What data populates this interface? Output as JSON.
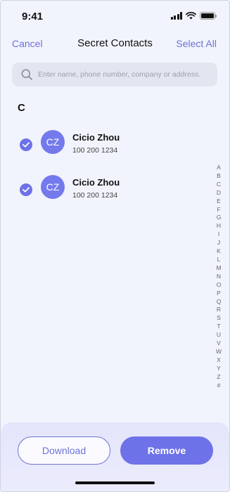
{
  "status": {
    "time": "9:41"
  },
  "nav": {
    "cancel": "Cancel",
    "title": "Secret Contacts",
    "select_all": "Select All"
  },
  "search": {
    "placeholder": "Enter name, phone number, company or address."
  },
  "section": {
    "letter": "C"
  },
  "contacts": [
    {
      "initials": "CZ",
      "name": "Cicio Zhou",
      "phone": "100 200 1234",
      "selected": true
    },
    {
      "initials": "CZ",
      "name": "Cicio Zhou",
      "phone": "100 200 1234",
      "selected": true
    }
  ],
  "alphabet": [
    "A",
    "B",
    "C",
    "D",
    "E",
    "F",
    "G",
    "H",
    "I",
    "J",
    "K",
    "L",
    "M",
    "N",
    "O",
    "P",
    "Q",
    "R",
    "S",
    "T",
    "U",
    "V",
    "W",
    "X",
    "Y",
    "Z",
    "#"
  ],
  "actions": {
    "download": "Download",
    "remove": "Remove"
  },
  "colors": {
    "accent": "#6e72e8",
    "background": "#f2f4fd",
    "search_bg": "#e3e6f1"
  }
}
